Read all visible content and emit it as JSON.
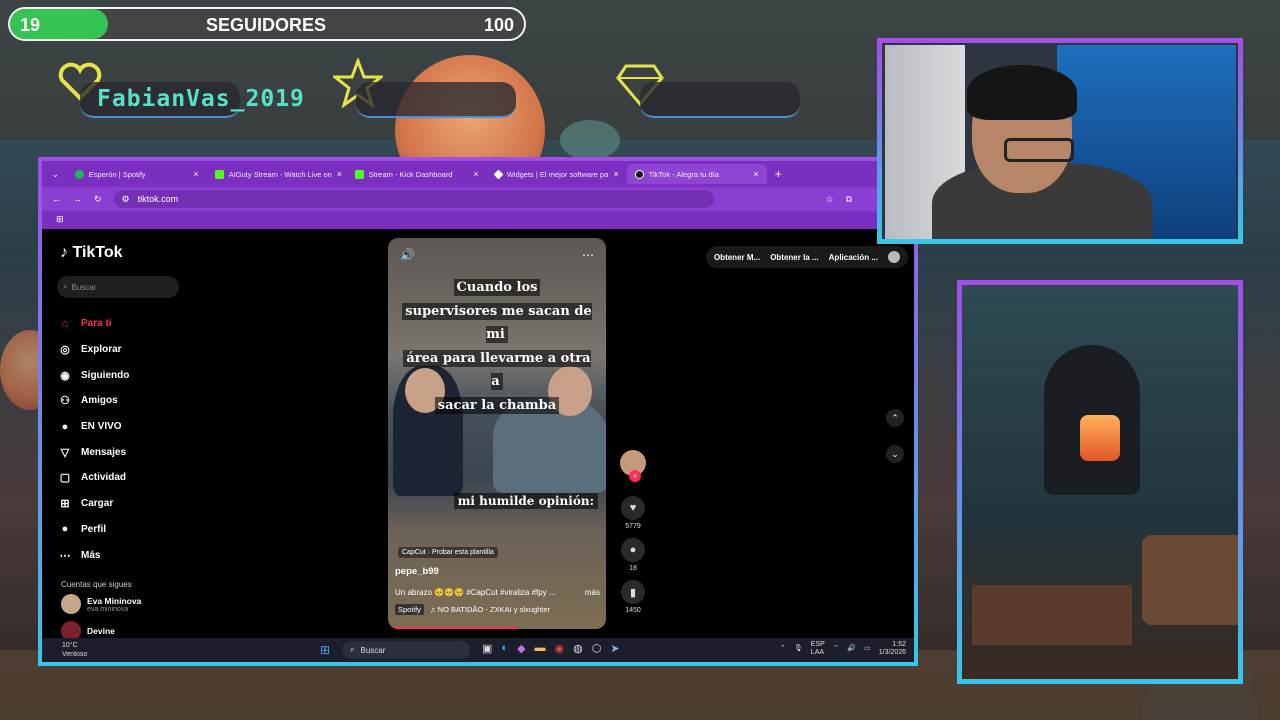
{
  "overlay": {
    "followers_current": "19",
    "followers_label": "SEGUIDORES",
    "followers_goal": "100",
    "followers_progress": 0.19,
    "latest_follower": "FabianVas_2019"
  },
  "browser": {
    "tabs": [
      {
        "label": "Esperón | Spotify",
        "color": "#1db954"
      },
      {
        "label": "AIGuty Stream - Watch Live on",
        "color": "#53fc18"
      },
      {
        "label": "Stream - Kick Dashboard",
        "color": "#53fc18"
      },
      {
        "label": "Widgets | El mejor software pa",
        "color": "#ffffff"
      },
      {
        "label": "TikTok - Alegra tu día",
        "color": "#111111"
      }
    ],
    "url": "tiktok.com"
  },
  "tiktok": {
    "logo": "TikTok",
    "search_placeholder": "Buscar",
    "nav": [
      {
        "label": "Para ti",
        "icon": "home-icon",
        "glyph": "⌂"
      },
      {
        "label": "Explorar",
        "icon": "compass-icon",
        "glyph": "◎"
      },
      {
        "label": "Siguiendo",
        "icon": "following-icon",
        "glyph": "◉"
      },
      {
        "label": "Amigos",
        "icon": "friends-icon",
        "glyph": "⚇"
      },
      {
        "label": "EN VIVO",
        "icon": "live-icon",
        "glyph": "●"
      },
      {
        "label": "Mensajes",
        "icon": "messages-icon",
        "glyph": "▽"
      },
      {
        "label": "Actividad",
        "icon": "activity-icon",
        "glyph": "▢"
      },
      {
        "label": "Cargar",
        "icon": "upload-icon",
        "glyph": "⊞"
      },
      {
        "label": "Perfil",
        "icon": "profile-icon",
        "glyph": "●"
      },
      {
        "label": "Más",
        "icon": "more-icon",
        "glyph": "⋯"
      }
    ],
    "following_title": "Cuentas que sigues",
    "accounts": [
      {
        "name": "Eva Mininova",
        "handle": "eva.mininova"
      },
      {
        "name": "Devine",
        "handle": ""
      }
    ],
    "top_actions": [
      "Obtener M...",
      "Obtener la ...",
      "Aplicación ..."
    ],
    "video": {
      "caption": [
        "Cuando los",
        "supervisores me sacan de mi",
        "área para llevarme a otra a",
        "sacar la chamba"
      ],
      "overlay_text": "mi humilde opinión:",
      "capcut": "CapCut · Probar esta plantilla",
      "username": "pepe_b99",
      "description": "Un abrazo 🥺🥺🥺 #CapCut #viraliza #fpy ...",
      "more": "más",
      "music_tag": "Spotify",
      "music": "♫  NO BATIDÃO - ZXKAI y slxughter"
    },
    "counts": {
      "likes": "5779",
      "comments": "18",
      "saves": "1450"
    }
  },
  "taskbar": {
    "temperature": "10°C",
    "weather": "Ventoso",
    "search": "Buscar",
    "lang_top": "ESP",
    "lang_bottom": "LAA",
    "time": "1:52",
    "date": "1/3/2026"
  }
}
